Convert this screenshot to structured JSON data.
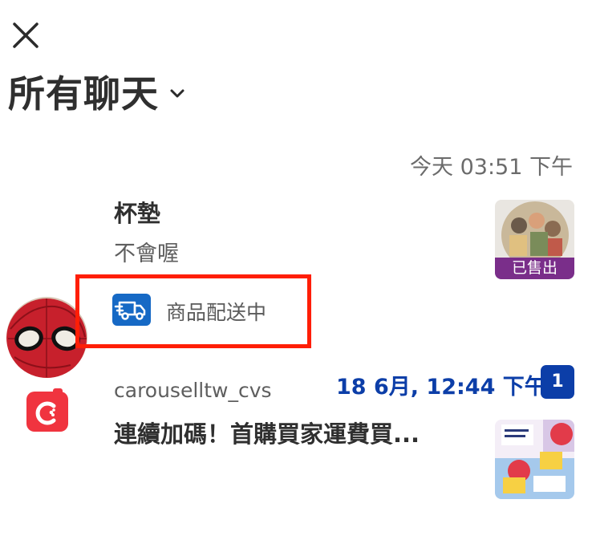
{
  "header": {
    "title": "所有聊天",
    "close_icon": "close-icon",
    "dropdown_icon": "chevron-down-icon"
  },
  "chats": [
    {
      "name": "杯墊",
      "message": "不會喔",
      "time": "今天 03:51 下午",
      "product_status": "已售出",
      "delivery_status": "商品配送中",
      "delivery_icon": "delivery-truck-icon"
    },
    {
      "name": "carouselltw_cvs",
      "message": "連續加碼！首購買家運費買...",
      "time": "18 6月, 12:44 下午",
      "unread_count": "1",
      "avatar_icon": "carousell-logo-icon"
    }
  ],
  "colors": {
    "accent_blue": "#0c3ea8",
    "sold_badge": "#7a2e8a",
    "highlight_box": "#ff1e06",
    "brand_red": "#f0343f"
  }
}
